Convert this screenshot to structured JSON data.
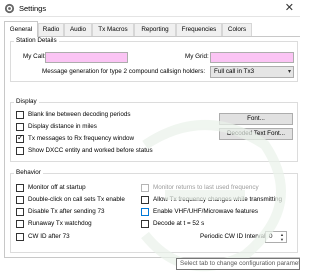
{
  "window": {
    "title": "Settings",
    "close_icon": "close-icon",
    "app_icon": "gear-icon"
  },
  "tabs": [
    {
      "label": "General",
      "active": true
    },
    {
      "label": "Radio"
    },
    {
      "label": "Audio"
    },
    {
      "label": "Tx Macros"
    },
    {
      "label": "Reporting"
    },
    {
      "label": "Frequencies"
    },
    {
      "label": "Colors"
    }
  ],
  "station": {
    "title": "Station Details",
    "my_call_label": "My Call:",
    "my_call_value": "",
    "my_grid_label": "My Grid:",
    "my_grid_value": "",
    "type2_label": "Message generation for type 2 compound callsign holders:",
    "type2_value": "Full call in Tx3"
  },
  "display": {
    "title": "Display",
    "options": [
      {
        "label": "Blank line between decoding periods",
        "checked": false
      },
      {
        "label": "Display distance in miles",
        "checked": false
      },
      {
        "label": "Tx messages to Rx frequency window",
        "checked": true
      },
      {
        "label": "Show DXCC entity and worked before status",
        "checked": false
      }
    ],
    "font_button": "Font...",
    "decoded_font_button": "Decoded Text Font..."
  },
  "behavior": {
    "title": "Behavior",
    "left": [
      {
        "label": "Monitor off at startup",
        "checked": false
      },
      {
        "label": "Double-click on call sets Tx enable",
        "checked": false
      },
      {
        "label": "Disable Tx after sending 73",
        "checked": false
      },
      {
        "label": "Runaway Tx watchdog",
        "checked": false
      },
      {
        "label": "CW ID after 73",
        "checked": false
      }
    ],
    "right": [
      {
        "label": "Monitor returns to last used frequency",
        "checked": false,
        "disabled": true
      },
      {
        "label": "Allow Tx frequency changes while transmitting",
        "checked": false
      },
      {
        "label": "Enable VHF/UHF/Microwave features",
        "checked": false
      },
      {
        "label": "Decode at t = 52 s",
        "checked": false
      }
    ],
    "cw_interval_label": "Periodic CW ID Interval:",
    "cw_interval_value": "0"
  },
  "tooltip": "Select tab to change configuration parameters",
  "colors": {
    "pink_field": "#fbc4f4",
    "accent_blue": "#0078d7"
  }
}
